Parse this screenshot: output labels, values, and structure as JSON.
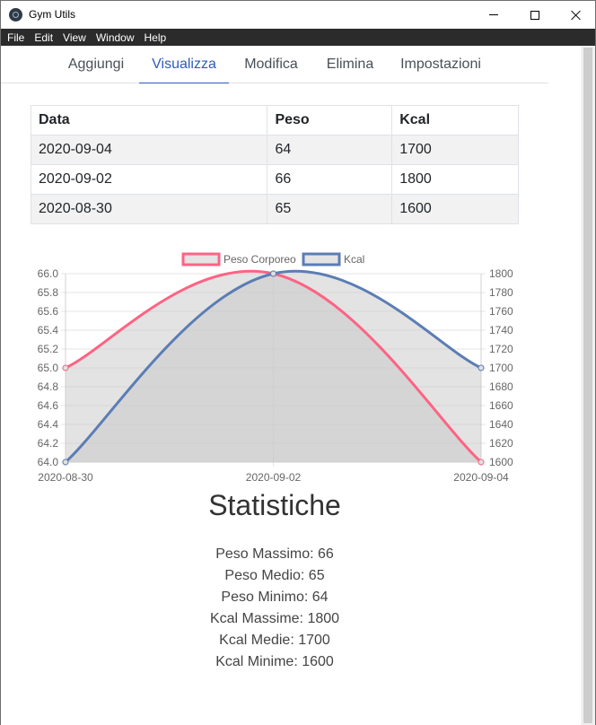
{
  "window": {
    "title": "Gym Utils"
  },
  "menu": [
    "File",
    "Edit",
    "View",
    "Window",
    "Help"
  ],
  "tabs": [
    {
      "label": "Aggiungi",
      "active": false
    },
    {
      "label": "Visualizza",
      "active": true
    },
    {
      "label": "Modifica",
      "active": false
    },
    {
      "label": "Elimina",
      "active": false
    },
    {
      "label": "Impostazioni",
      "active": false
    }
  ],
  "table": {
    "headers": [
      "Data",
      "Peso",
      "Kcal"
    ],
    "rows": [
      [
        "2020-09-04",
        "64",
        "1700"
      ],
      [
        "2020-09-02",
        "66",
        "1800"
      ],
      [
        "2020-08-30",
        "65",
        "1600"
      ]
    ]
  },
  "chart_data": {
    "type": "area",
    "x": [
      "2020-08-30",
      "2020-09-02",
      "2020-09-04"
    ],
    "series": [
      {
        "name": "Peso Corporeo",
        "values": [
          65,
          66,
          64
        ],
        "axis": "left",
        "color": "#ff6384"
      },
      {
        "name": "Kcal",
        "values": [
          1600,
          1800,
          1700
        ],
        "axis": "right",
        "color": "#5b7db5"
      }
    ],
    "y_left": {
      "range": [
        64.0,
        66.0
      ],
      "ticks": [
        "66.0",
        "65.8",
        "65.6",
        "65.4",
        "65.2",
        "65.0",
        "64.8",
        "64.6",
        "64.4",
        "64.2",
        "64.0"
      ]
    },
    "y_right": {
      "range": [
        1600,
        1800
      ],
      "ticks": [
        "1800",
        "1780",
        "1760",
        "1740",
        "1720",
        "1700",
        "1680",
        "1660",
        "1640",
        "1620",
        "1600"
      ]
    },
    "legend": "top",
    "grid": true,
    "fill_color": "#c8c8c8"
  },
  "stats": {
    "title": "Statistiche",
    "lines": [
      "Peso Massimo: 66",
      "Peso Medio: 65",
      "Peso Minimo: 64",
      "Kcal Massime: 1800",
      "Kcal Medie: 1700",
      "Kcal Minime: 1600"
    ]
  }
}
